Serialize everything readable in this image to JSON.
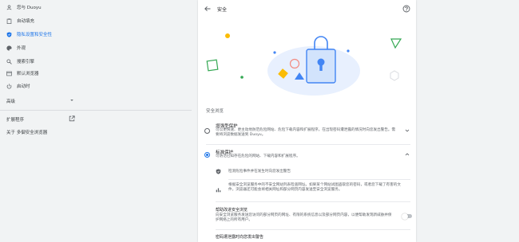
{
  "sidebar": {
    "items": [
      {
        "label": "您与 Duoyu",
        "icon": "person-icon"
      },
      {
        "label": "自动填充",
        "icon": "clipboard-icon"
      },
      {
        "label": "隐私设置和安全性",
        "icon": "shield-icon"
      },
      {
        "label": "外观",
        "icon": "palette-icon"
      },
      {
        "label": "搜索引擎",
        "icon": "search-icon"
      },
      {
        "label": "默认浏览器",
        "icon": "browser-icon"
      },
      {
        "label": "启动时",
        "icon": "power-icon"
      }
    ],
    "active_index": 2,
    "advanced_label": "高级",
    "extensions_label": "扩展程序",
    "about_label": "关于 多御安全浏览器"
  },
  "main": {
    "title": "安全",
    "section_label": "安全浏览",
    "options": [
      {
        "title": "增强型保护",
        "description": "可以更快速、更主动地防范危险网站、危险下载内容和扩展程序。在出现密码遭泄露的情况时向您发出警告。需要将浏览数据发送到 Duoyu。",
        "checked": false,
        "expanded": false
      },
      {
        "title": "标准保护",
        "description": "可防范已知存在危险的网站、下载内容和扩展程序。",
        "checked": true,
        "expanded": true
      }
    ],
    "details": [
      {
        "icon": "shield-check-icon",
        "text": "检测危险事件并在发生时向您发出警告"
      },
      {
        "icon": "bar-chart-icon",
        "text": "根据安全浏览服务中的不安全网站列表检查网址。如果某个网站试图盗取您的密码，或者您下载了有害的文件，浏览器还可能会将相关网址和部分网页内容发送至安全浏览服务。"
      }
    ],
    "toggle": {
      "title": "帮助改进安全浏览",
      "description": "向安全浏览服务发送您访问的部分网页的网址、有限的系统信息以及部分网页内容，以便帮助发现新威胁并保护网络上的所有用户。",
      "enabled": false
    },
    "bottom_item": "密码遭泄露时向您发出警告"
  },
  "colors": {
    "accent": "#1a73e8",
    "illustration_blue": "#4285f4",
    "illustration_green": "#34a853",
    "illustration_yellow": "#fbbc04",
    "illustration_pink": "#f28b82"
  }
}
